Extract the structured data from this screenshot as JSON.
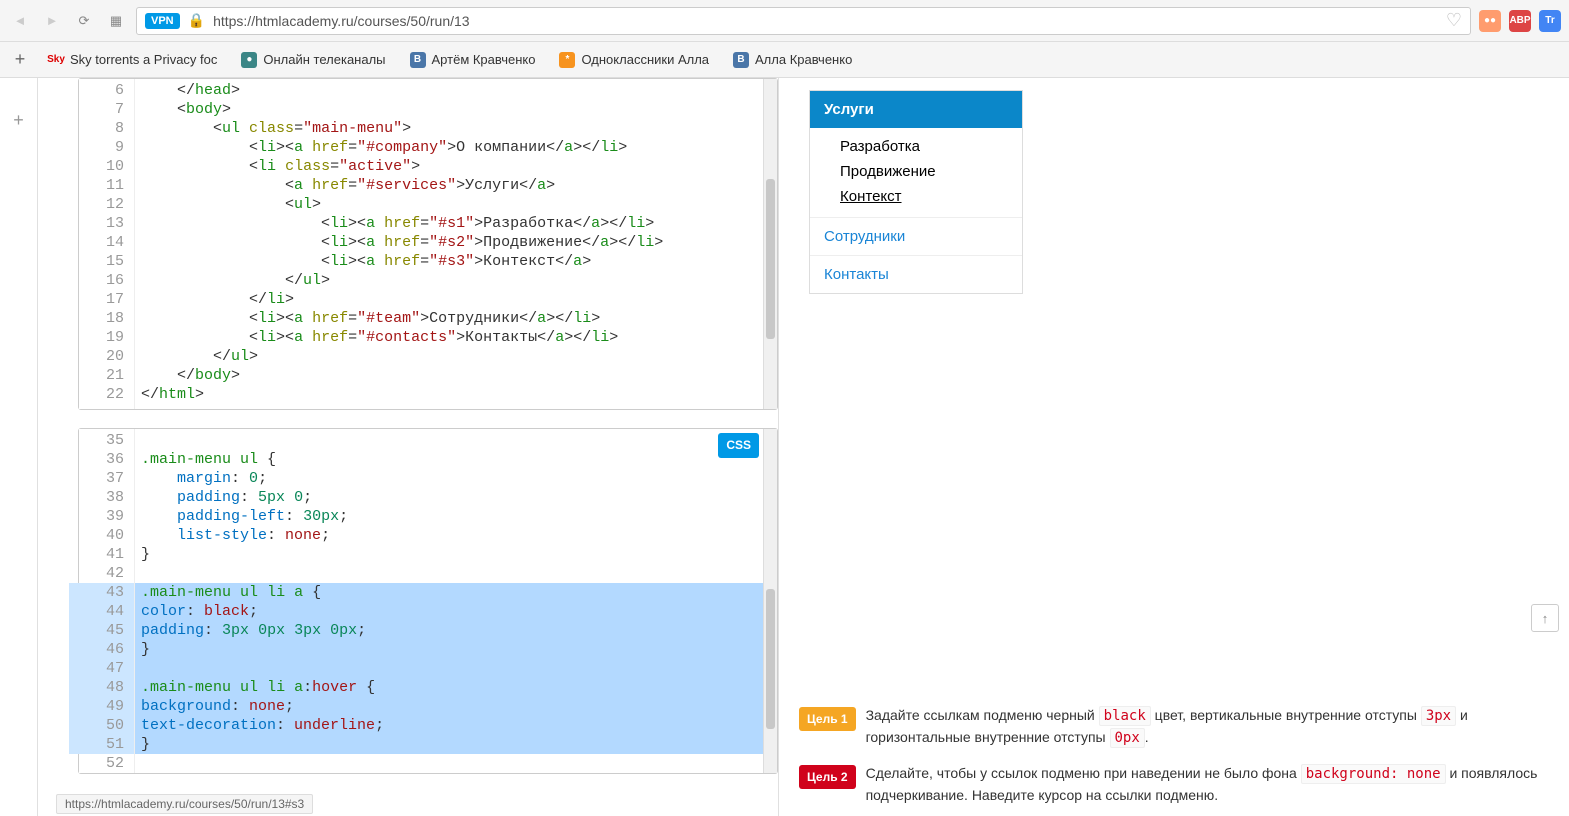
{
  "browser": {
    "url": "https://htmlacademy.ru/courses/50/run/13",
    "vpn": "VPN",
    "extensions": [
      {
        "name": "ext1",
        "bg": "#ff9c6e"
      },
      {
        "name": "ABP",
        "bg": "#d44"
      },
      {
        "name": "Tr",
        "bg": "#4285f4"
      }
    ]
  },
  "bookmarks": [
    {
      "label": "Sky torrents a Privacy foc",
      "icon": "Sky",
      "bg": "transparent",
      "color": "#d00"
    },
    {
      "label": "Онлайн телеканалы",
      "icon": "●",
      "bg": "#3b8686",
      "color": "#fff"
    },
    {
      "label": "Артём Кравченко",
      "icon": "B",
      "bg": "#4a76a8",
      "color": "#fff"
    },
    {
      "label": "Одноклассники Алла",
      "icon": "*",
      "bg": "#f7931e",
      "color": "#fff"
    },
    {
      "label": "Алла Кравченко",
      "icon": "B",
      "bg": "#4a76a8",
      "color": "#fff"
    }
  ],
  "html_editor": {
    "start": 6,
    "lines": [
      {
        "n": 6,
        "html": "    &lt;/<span class='tag'>head</span>&gt;"
      },
      {
        "n": 7,
        "html": "    &lt;<span class='tag'>body</span>&gt;"
      },
      {
        "n": 8,
        "html": "        &lt;<span class='tag'>ul</span> <span class='attr-name'>class</span>=<span class='str'>\"main-menu\"</span>&gt;"
      },
      {
        "n": 9,
        "html": "            &lt;<span class='tag'>li</span>&gt;&lt;<span class='tag'>a</span> <span class='attr-name'>href</span>=<span class='str'>\"#company\"</span>&gt;О компании&lt;/<span class='tag'>a</span>&gt;&lt;/<span class='tag'>li</span>&gt;"
      },
      {
        "n": 10,
        "html": "            &lt;<span class='tag'>li</span> <span class='attr-name'>class</span>=<span class='str'>\"active\"</span>&gt;"
      },
      {
        "n": 11,
        "html": "                &lt;<span class='tag'>a</span> <span class='attr-name'>href</span>=<span class='str'>\"#services\"</span>&gt;Услуги&lt;/<span class='tag'>a</span>&gt;"
      },
      {
        "n": 12,
        "html": "                &lt;<span class='tag'>ul</span>&gt;"
      },
      {
        "n": 13,
        "html": "                    &lt;<span class='tag'>li</span>&gt;&lt;<span class='tag'>a</span> <span class='attr-name'>href</span>=<span class='str'>\"#s1\"</span>&gt;Разработка&lt;/<span class='tag'>a</span>&gt;&lt;/<span class='tag'>li</span>&gt;"
      },
      {
        "n": 14,
        "html": "                    &lt;<span class='tag'>li</span>&gt;&lt;<span class='tag'>a</span> <span class='attr-name'>href</span>=<span class='str'>\"#s2\"</span>&gt;Продвижение&lt;/<span class='tag'>a</span>&gt;&lt;/<span class='tag'>li</span>&gt;"
      },
      {
        "n": 15,
        "html": "                    &lt;<span class='tag'>li</span>&gt;&lt;<span class='tag'>a</span> <span class='attr-name'>href</span>=<span class='str'>\"#s3\"</span>&gt;Контекст&lt;/<span class='tag'>a</span>&gt;"
      },
      {
        "n": 16,
        "html": "                &lt;/<span class='tag'>ul</span>&gt;"
      },
      {
        "n": 17,
        "html": "            &lt;/<span class='tag'>li</span>&gt;"
      },
      {
        "n": 18,
        "html": "            &lt;<span class='tag'>li</span>&gt;&lt;<span class='tag'>a</span> <span class='attr-name'>href</span>=<span class='str'>\"#team\"</span>&gt;Сотрудники&lt;/<span class='tag'>a</span>&gt;&lt;/<span class='tag'>li</span>&gt;"
      },
      {
        "n": 19,
        "html": "            &lt;<span class='tag'>li</span>&gt;&lt;<span class='tag'>a</span> <span class='attr-name'>href</span>=<span class='str'>\"#contacts\"</span>&gt;Контакты&lt;/<span class='tag'>a</span>&gt;&lt;/<span class='tag'>li</span>&gt;"
      },
      {
        "n": 20,
        "html": "        &lt;/<span class='tag'>ul</span>&gt;"
      },
      {
        "n": 21,
        "html": "    &lt;/<span class='tag'>body</span>&gt;"
      },
      {
        "n": 22,
        "html": "&lt;/<span class='tag'>html</span>&gt;"
      }
    ]
  },
  "css_editor": {
    "badge": "CSS",
    "lines": [
      {
        "n": 35,
        "html": " ",
        "hl": false
      },
      {
        "n": 36,
        "html": "<span class='sel'>.main-menu</span> <span class='tag'>ul</span> {",
        "hl": false
      },
      {
        "n": 37,
        "html": "    <span class='prop'>margin</span>: <span class='num'>0</span>;",
        "hl": false
      },
      {
        "n": 38,
        "html": "    <span class='prop'>padding</span>: <span class='num'>5px</span> <span class='num'>0</span>;",
        "hl": false
      },
      {
        "n": 39,
        "html": "    <span class='prop'>padding-left</span>: <span class='num'>30px</span>;",
        "hl": false
      },
      {
        "n": 40,
        "html": "    <span class='prop'>list-style</span>: <span class='kw'>none</span>;",
        "hl": false
      },
      {
        "n": 41,
        "html": "}",
        "hl": false
      },
      {
        "n": 42,
        "html": " ",
        "hl": false
      },
      {
        "n": 43,
        "html": "<span class='sel'>.main-menu</span> <span class='tag'>ul</span> <span class='tag'>li</span> <span class='tag'>a</span> {",
        "hl": true
      },
      {
        "n": 44,
        "html": "<span class='prop'>color</span>: <span class='kw'>black</span>;",
        "hl": true
      },
      {
        "n": 45,
        "html": "<span class='prop'>padding</span>: <span class='num'>3px</span> <span class='num'>0px</span> <span class='num'>3px</span> <span class='num'>0px</span>;",
        "hl": true
      },
      {
        "n": 46,
        "html": "}",
        "hl": true
      },
      {
        "n": 47,
        "html": " ",
        "hl": true
      },
      {
        "n": 48,
        "html": "<span class='sel'>.main-menu</span> <span class='tag'>ul</span> <span class='tag'>li</span> <span class='tag'>a</span>:<span class='kw'>hover</span> {",
        "hl": true
      },
      {
        "n": 49,
        "html": "<span class='prop'>background</span>: <span class='kw'>none</span>;",
        "hl": true
      },
      {
        "n": 50,
        "html": "<span class='prop'>text-decoration</span>: <span class='kw'>underline</span>;",
        "hl": true
      },
      {
        "n": 51,
        "html": "}",
        "hl": true
      },
      {
        "n": 52,
        "html": " ",
        "hl": false
      }
    ]
  },
  "preview": {
    "active": "Услуги",
    "sub": [
      "Разработка",
      "Продвижение",
      "Контекст"
    ],
    "hover_index": 2,
    "items": [
      "Сотрудники",
      "Контакты"
    ]
  },
  "goals": [
    {
      "badge": "Цель 1",
      "cls": "g1",
      "text_parts": [
        "Задайте ссылкам подменю черный ",
        "black",
        " цвет, вертикальные внутренние отступы ",
        "3px",
        " и горизонтальные внутренние отступы ",
        "0px",
        "."
      ]
    },
    {
      "badge": "Цель 2",
      "cls": "g2",
      "text_parts": [
        "Сделайте, чтобы у ссылок подменю при наведении не было фона ",
        "background: none",
        " и появлялось подчеркивание. Наведите курсор на ссылки подменю."
      ]
    }
  ],
  "status_url": "https://htmlacademy.ru/courses/50/run/13#s3"
}
